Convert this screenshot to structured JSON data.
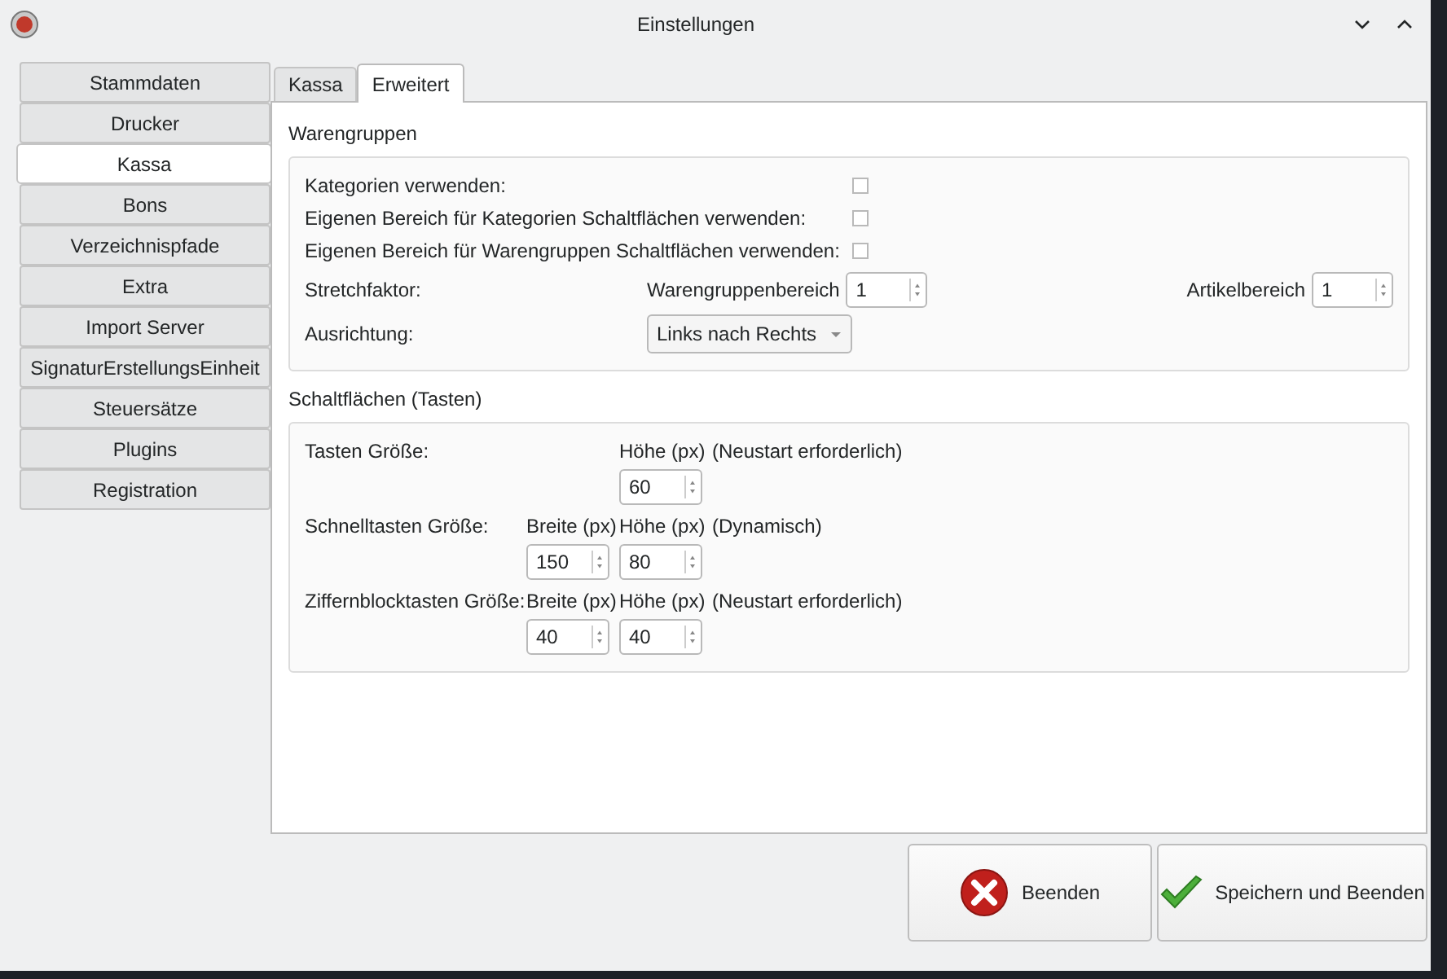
{
  "window": {
    "title": "Einstellungen"
  },
  "sidebar": {
    "items": [
      {
        "label": "Stammdaten",
        "selected": false
      },
      {
        "label": "Drucker",
        "selected": false
      },
      {
        "label": "Kassa",
        "selected": true
      },
      {
        "label": "Bons",
        "selected": false
      },
      {
        "label": "Verzeichnispfade",
        "selected": false
      },
      {
        "label": "Extra",
        "selected": false
      },
      {
        "label": "Import Server",
        "selected": false
      },
      {
        "label": "SignaturErstellungsEinheit",
        "selected": false
      },
      {
        "label": "Steuersätze",
        "selected": false
      },
      {
        "label": "Plugins",
        "selected": false
      },
      {
        "label": "Registration",
        "selected": false
      }
    ]
  },
  "tabs": [
    {
      "label": "Kassa",
      "selected": false
    },
    {
      "label": "Erweitert",
      "selected": true
    }
  ],
  "warengruppen": {
    "title": "Warengruppen",
    "checkboxes": [
      {
        "label": "Kategorien verwenden:",
        "checked": false
      },
      {
        "label": "Eigenen Bereich für Kategorien Schaltflächen verwenden:",
        "checked": false
      },
      {
        "label": "Eigenen Bereich für Warengruppen Schaltflächen verwenden:",
        "checked": false
      }
    ],
    "stretch": {
      "label": "Stretchfaktor:",
      "fields": [
        {
          "label": "Warengruppenbereich",
          "value": "1"
        },
        {
          "label": "Artikelbereich",
          "value": "1"
        }
      ]
    },
    "alignment": {
      "label": "Ausrichtung:",
      "value": "Links nach Rechts"
    }
  },
  "schaltflaechen": {
    "title": "Schaltflächen (Tasten)",
    "rows": [
      {
        "label": "Tasten Größe:",
        "columns": [
          {
            "kind": "height",
            "header": "Höhe (px)",
            "value": "60"
          }
        ],
        "note": "(Neustart erforderlich)"
      },
      {
        "label": "Schnelltasten Größe:",
        "columns": [
          {
            "kind": "width",
            "header": "Breite (px)",
            "value": "150"
          },
          {
            "kind": "height",
            "header": "Höhe (px)",
            "value": "80"
          }
        ],
        "note": "(Dynamisch)"
      },
      {
        "label": "Ziffernblocktasten Größe:",
        "columns": [
          {
            "kind": "width",
            "header": "Breite (px)",
            "value": "40"
          },
          {
            "kind": "height",
            "header": "Höhe (px)",
            "value": "40"
          }
        ],
        "note": "(Neustart erforderlich)"
      }
    ]
  },
  "buttons": [
    {
      "label": "Beenden",
      "kind": "cancel"
    },
    {
      "label": "Speichern und Beenden",
      "kind": "save"
    }
  ]
}
